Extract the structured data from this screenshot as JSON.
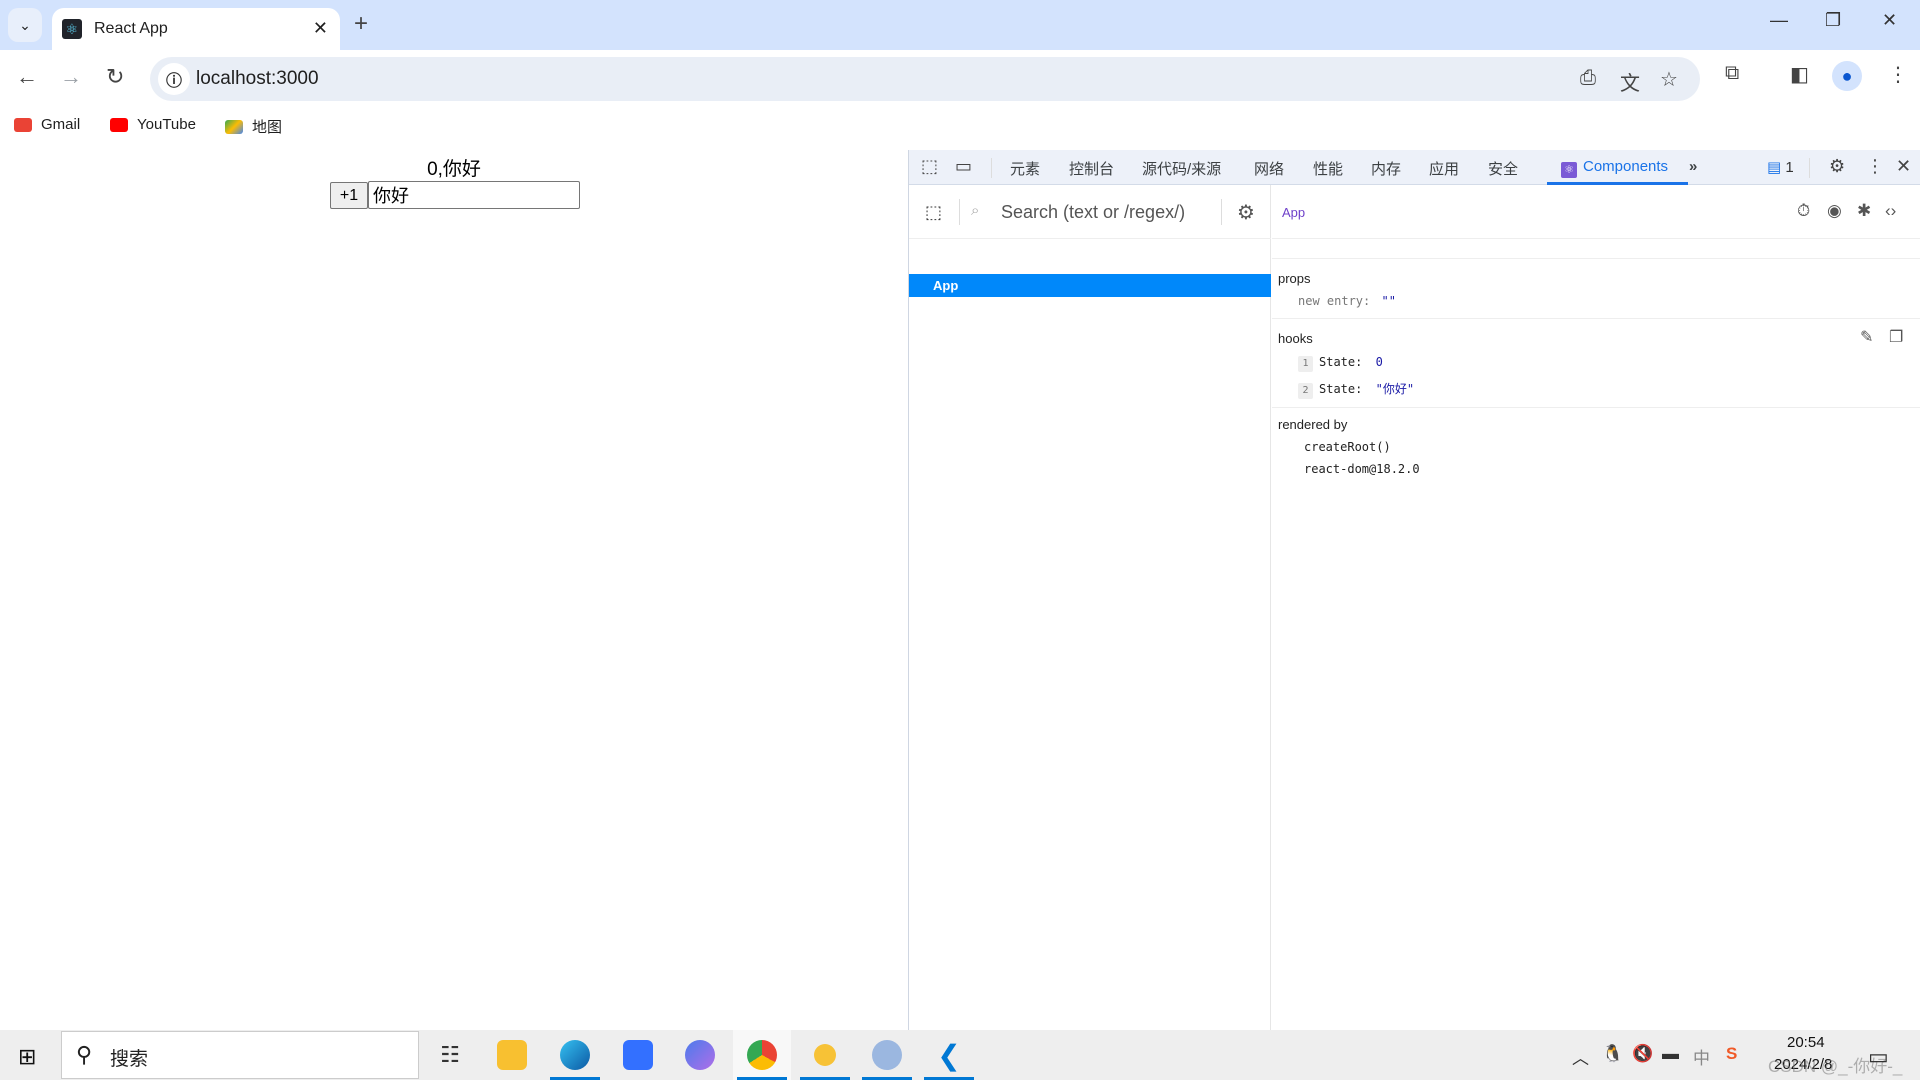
{
  "browser": {
    "tab_title": "React App",
    "url": "localhost:3000",
    "bookmarks": [
      {
        "label": "Gmail",
        "icon": "gmail-icon",
        "color": "#ea4335"
      },
      {
        "label": "YouTube",
        "icon": "youtube-icon",
        "color": "#ff0000"
      },
      {
        "label": "地图",
        "icon": "maps-icon",
        "color": "#34a853"
      }
    ],
    "accent": "#d3e3fd"
  },
  "page": {
    "counter_text": "0,你好",
    "plus_button": "+1",
    "input_value": "你好"
  },
  "devtools": {
    "tabs": [
      "元素",
      "控制台",
      "源代码/来源",
      "网络",
      "性能",
      "内存",
      "应用",
      "安全",
      "Components"
    ],
    "active_tab": "Components",
    "more_tabs": "»",
    "issues_count": "1",
    "search_placeholder": "Search (text or /regex/)",
    "tree": [
      {
        "label": "App",
        "selected": true
      }
    ],
    "selected_component": "App",
    "props_title": "props",
    "props": [
      {
        "key": "new entry",
        "value": "\"\""
      }
    ],
    "hooks_title": "hooks",
    "hooks": [
      {
        "index": "1",
        "name": "State:",
        "value": "0"
      },
      {
        "index": "2",
        "name": "State:",
        "value": "\"你好\""
      }
    ],
    "rendered_by_title": "rendered by",
    "rendered_by": [
      "createRoot()",
      "react-dom@18.2.0"
    ],
    "selection_color": "#0088fa"
  },
  "taskbar": {
    "search_label": "搜索",
    "apps": [
      "task-view",
      "file-explorer",
      "edge",
      "feishu",
      "copilot",
      "chrome",
      "app-yellow",
      "app-robot",
      "vscode"
    ],
    "tray_ime": "中",
    "time": "20:54",
    "date": "2024/2/8",
    "watermark": "CSDN @_-你好-_"
  }
}
